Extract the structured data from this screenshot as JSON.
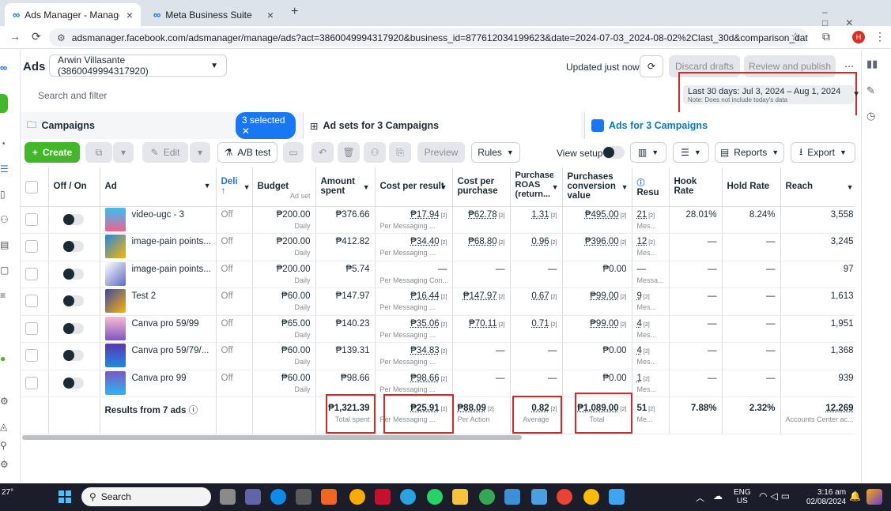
{
  "browser": {
    "tabs": [
      {
        "label": "Ads Manager - Manage ads - A"
      },
      {
        "label": "Meta Business Suite"
      }
    ],
    "url": "adsmanager.facebook.com/adsmanager/manage/ads?act=3860049994317920&business_id=877612034199623&date=2024-07-03_2024-08-02%2Clast_30d&comparison_date=&insights...",
    "profile_initial": "H"
  },
  "header": {
    "title": "Ads",
    "account": "Arwin Villasante (3860049994317920)",
    "updated": "Updated just now",
    "discard": "Discard drafts",
    "review": "Review and publish"
  },
  "search": {
    "placeholder": "Search and filter"
  },
  "date": {
    "range": "Last 30 days: Jul 3, 2024 – Aug 1, 2024",
    "note": "Note: Does not include today's data"
  },
  "levels": {
    "campaigns": "Campaigns",
    "selected": "3 selected",
    "adsets": "Ad sets for 3 Campaigns",
    "ads": "Ads for 3 Campaigns"
  },
  "toolbar": {
    "create": "Create",
    "edit": "Edit",
    "abtest": "A/B test",
    "preview": "Preview",
    "rules": "Rules",
    "view_setup": "View setup",
    "reports": "Reports",
    "export": "Export"
  },
  "columns": {
    "offon": "Off / On",
    "ad": "Ad",
    "delivery": "Deli",
    "budget": "Budget",
    "budget_sub": "Ad set",
    "amount_spent": "Amount spent",
    "cost_per_result": "Cost per result",
    "cost_per_purchase": "Cost per purchase",
    "roas": "Purchase ROAS (return...",
    "conv_value": "Purchases conversion value",
    "results": "Resu",
    "hook": "Hook Rate",
    "hold": "Hold Rate",
    "reach": "Reach"
  },
  "rows": [
    {
      "name": "video-ugc - 3",
      "delivery": "Off",
      "budget": "₱200.00",
      "budget_sub": "Daily",
      "spent": "₱376.66",
      "cpr": "₱17.94",
      "cpr_sub": "Per Messaging ...",
      "cpp": "₱62.78",
      "roas": "1.31",
      "conv": "₱495.00",
      "results": "21",
      "results_sub": "Mes...",
      "hook": "28.01%",
      "hold": "8.24%",
      "reach": "3,558"
    },
    {
      "name": "image-pain points...",
      "delivery": "Off",
      "budget": "₱200.00",
      "budget_sub": "Daily",
      "spent": "₱412.82",
      "cpr": "₱34.40",
      "cpr_sub": "Per Messaging ...",
      "cpp": "₱68.80",
      "roas": "0.96",
      "conv": "₱396.00",
      "results": "12",
      "results_sub": "Mes...",
      "hook": "—",
      "hold": "—",
      "reach": "3,245"
    },
    {
      "name": "image-pain points...",
      "delivery": "Off",
      "budget": "₱200.00",
      "budget_sub": "Daily",
      "spent": "₱5.74",
      "cpr": "—",
      "cpr_sub": "Per Messaging Con...",
      "cpp": "—",
      "roas": "—",
      "conv": "₱0.00",
      "results": "—",
      "results_sub": "Messa...",
      "hook": "—",
      "hold": "—",
      "reach": "97"
    },
    {
      "name": "Test 2",
      "delivery": "Off",
      "budget": "₱60.00",
      "budget_sub": "Daily",
      "spent": "₱147.97",
      "cpr": "₱16.44",
      "cpr_sub": "Per Messaging ...",
      "cpp": "₱147.97",
      "roas": "0.67",
      "conv": "₱99.00",
      "results": "9",
      "results_sub": "Mes...",
      "hook": "—",
      "hold": "—",
      "reach": "1,613"
    },
    {
      "name": "Canva pro 59/99",
      "delivery": "Off",
      "budget": "₱65.00",
      "budget_sub": "Daily",
      "spent": "₱140.23",
      "cpr": "₱35.06",
      "cpr_sub": "Per Messaging ...",
      "cpp": "₱70.11",
      "roas": "0.71",
      "conv": "₱99.00",
      "results": "4",
      "results_sub": "Mes...",
      "hook": "—",
      "hold": "—",
      "reach": "1,951"
    },
    {
      "name": "Canva pro 59/79/...",
      "delivery": "Off",
      "budget": "₱60.00",
      "budget_sub": "Daily",
      "spent": "₱139.31",
      "cpr": "₱34.83",
      "cpr_sub": "Per Messaging ...",
      "cpp": "—",
      "roas": "—",
      "conv": "₱0.00",
      "results": "4",
      "results_sub": "Mes...",
      "hook": "—",
      "hold": "—",
      "reach": "1,368"
    },
    {
      "name": "Canva pro 99",
      "delivery": "Off",
      "budget": "₱60.00",
      "budget_sub": "Daily",
      "spent": "₱98.66",
      "cpr": "₱98.66",
      "cpr_sub": "Per Messaging ...",
      "cpp": "—",
      "roas": "—",
      "conv": "₱0.00",
      "results": "1",
      "results_sub": "Mes...",
      "hook": "—",
      "hold": "—",
      "reach": "939"
    }
  ],
  "totals": {
    "label": "Results from 7 ads",
    "spent": "₱1,321.39",
    "spent_sub": "Total spent",
    "cpr": "₱25.91",
    "cpr_sub": "Per Messaging ...",
    "cpp": "₱88.09",
    "cpp_sub": "Per Action",
    "roas": "0.82",
    "roas_sub": "Average",
    "conv": "₱1,089.00",
    "conv_sub": "Total",
    "results": "51",
    "results_sub": "Me...",
    "hook": "7.88%",
    "hold": "2.32%",
    "reach": "12,269",
    "reach_sub": "Accounts Center ac..."
  },
  "taskbar": {
    "weather": "27°",
    "search": "Search",
    "lang1": "ENG",
    "lang2": "US",
    "time": "3:16 am",
    "date": "02/08/2024"
  },
  "colors": {
    "accent": "#1877f2",
    "create": "#42b72a",
    "highlight": "#e02424"
  }
}
